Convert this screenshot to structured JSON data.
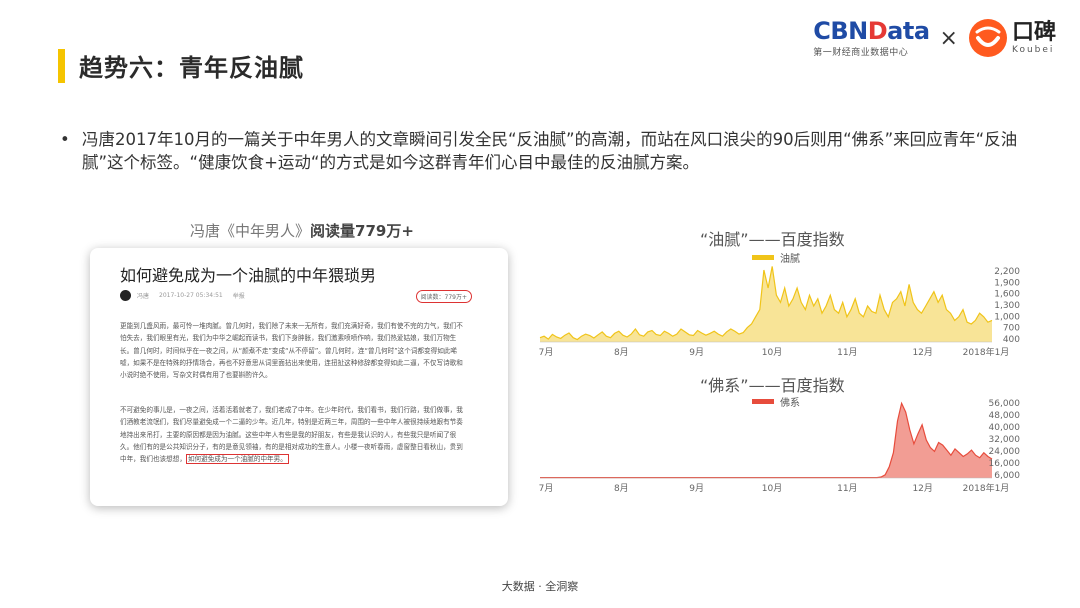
{
  "header": {
    "title": "趋势六：青年反油腻"
  },
  "logos": {
    "cbn_part1": "CBN",
    "cbn_part2": "D",
    "cbn_part3": "ata",
    "cbn_sub": "第一财经商业数据中心",
    "times": "×",
    "koubei_cn": "口碑",
    "koubei_en": "Koubei"
  },
  "bullet": {
    "dot": "•",
    "text": "冯唐2017年10月的一篇关于中年男人的文章瞬间引发全民“反油腻”的高潮，而站在风口浪尖的90后则用“佛系”来回应青年“反油腻”这个标签。“健康饮食+运动“的方式是如今这群青年们心目中最佳的反油腻方案。"
  },
  "article": {
    "caption_prefix": "冯唐《中年男人》",
    "caption_bold": "阅读量779万+",
    "title": "如何避免成为一个油腻的中年猥琐男",
    "author": "冯唐",
    "date": "2017-10-27 05:34:51",
    "tag": "举报",
    "reads": "阅读数：779万+",
    "para1": "更能到几盏风雨，最可怜一堆肉腻。曾几何时，我们除了未来一无所有，我们充满好奇，我们有使不完的力气，我们不怕失去，我们眼里有光，我们为中华之崛起而读书，我们下身肿胀，我们激素喷喷作响，我们热爱姑娘，我们万物生长。曾几何时，时间似乎在一夜之间，从“颜煮不走”变成“从不停留”。曾几何时，连“曾几何时”这个词都变得如此唏嘘，如果不是在特殊的抒情场合，再也不好意思从词里面拈出来使用，连扭扯这种修辞都变得如此二逼，不仅写诗歌和小说时绝不使用，写杂文时偶有用了也要斟酌许久。",
    "para2_main": "不可避免的事儿是，一夜之间，活着活着就老了，我们老成了中年。在少年时代，我们看书，我们行路，我们做事，我们酒教老流氓们，我们尽量避免成一个二逼的少年。近几年，特别是近两三年，周围的一些中年人被很持续地跟有节奏地持出来吊打，主要的原因都是因为油腻。这些中年人有些是我的好朋友，有些是我认识的人，有些我只是听闻了很久。他们有的是公共知识分子，有的是意见领袖，有的是相对成功的生意人。小楼一夜听春雨，虚窗整日看秋山，贵到中年，我们也该想想，",
    "para2_hl": "如何避免成为一个油腻的中年男。"
  },
  "chart_data": [
    {
      "type": "area",
      "title": "“油腻”——百度指数",
      "series": [
        {
          "name": "油腻",
          "color": "#f0c419",
          "values": [
            520,
            560,
            480,
            610,
            540,
            500,
            590,
            650,
            520,
            470,
            560,
            620,
            580,
            510,
            600,
            680,
            560,
            520,
            640,
            700,
            590,
            540,
            620,
            760,
            600,
            560,
            680,
            720,
            610,
            580,
            700,
            640,
            560,
            620,
            760,
            680,
            600,
            580,
            720,
            650,
            590,
            640,
            700,
            620,
            560,
            680,
            760,
            700,
            620,
            660,
            800,
            900,
            1100,
            1300,
            2400,
            1900,
            2500,
            1700,
            1500,
            1900,
            1400,
            1600,
            1900,
            1500,
            1300,
            1700,
            1400,
            1600,
            1200,
            1400,
            1700,
            1300,
            1200,
            1500,
            1100,
            1300,
            1600,
            1200,
            1100,
            1400,
            1250,
            1200,
            1700,
            1300,
            1100,
            1500,
            1600,
            1800,
            1400,
            2000,
            1500,
            1300,
            1200,
            1400,
            1600,
            1800,
            1500,
            1700,
            1300,
            1200,
            1000,
            1100,
            1300,
            950,
            900,
            1000,
            1200,
            1100,
            950,
            1000
          ]
        }
      ],
      "x_labels": [
        "7月",
        "8月",
        "9月",
        "10月",
        "11月",
        "12月",
        "2018年1月"
      ],
      "y_ticks": [
        "2,200",
        "1,900",
        "1,600",
        "1,300",
        "1,000",
        "700",
        "400"
      ],
      "ylim": [
        400,
        2400
      ]
    },
    {
      "type": "area",
      "title": "“佛系”——百度指数",
      "series": [
        {
          "name": "佛系",
          "color": "#e74c3c",
          "values": [
            300,
            300,
            300,
            300,
            300,
            300,
            300,
            300,
            300,
            300,
            300,
            300,
            300,
            300,
            300,
            300,
            300,
            300,
            300,
            300,
            300,
            300,
            300,
            300,
            300,
            300,
            300,
            300,
            300,
            300,
            300,
            300,
            300,
            300,
            300,
            300,
            300,
            300,
            300,
            300,
            300,
            300,
            300,
            300,
            300,
            300,
            300,
            300,
            300,
            300,
            300,
            300,
            300,
            300,
            300,
            300,
            300,
            300,
            300,
            300,
            300,
            300,
            300,
            300,
            300,
            300,
            300,
            300,
            300,
            300,
            300,
            300,
            300,
            300,
            300,
            300,
            300,
            300,
            300,
            300,
            300,
            300,
            300,
            800,
            2500,
            9000,
            20000,
            45000,
            59000,
            52000,
            38000,
            27000,
            35000,
            42000,
            30000,
            24000,
            21000,
            28000,
            26000,
            22000,
            18000,
            23000,
            20000,
            17000,
            19000,
            22000,
            18000,
            16000,
            20000,
            17000,
            15000
          ]
        }
      ],
      "x_labels": [
        "7月",
        "8月",
        "9月",
        "10月",
        "11月",
        "12月",
        "2018年1月"
      ],
      "y_ticks": [
        "56,000",
        "48,000",
        "40,000",
        "32,000",
        "24,000",
        "16,000",
        "6,000"
      ],
      "ylim": [
        0,
        60000
      ]
    }
  ],
  "footer": {
    "text": "大数据 · 全洞察"
  }
}
